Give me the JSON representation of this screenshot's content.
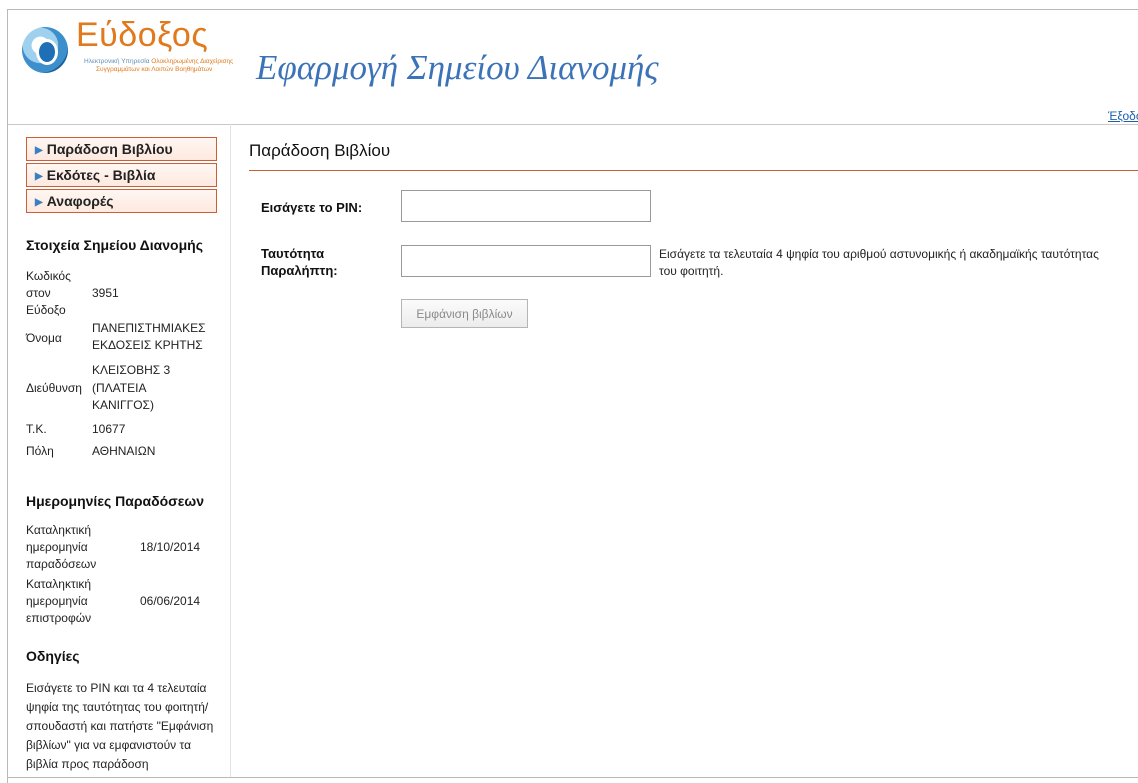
{
  "header": {
    "logo_title": "Εύδοξος",
    "logo_sub_prefix": "Ηλεκτρονική Υπηρεσία ",
    "logo_sub_accent": "Ολοκληρωμένης Διαχείρισης",
    "logo_sub_line2": "Συγγραμμάτων και Λοιπών Βοηθημάτων",
    "app_title": "Εφαρμογή Σημείου Διανομής",
    "logout_label": "Έξοδο"
  },
  "sidebar": {
    "menu": [
      {
        "label": "Παράδοση Βιβλίου"
      },
      {
        "label": "Εκδότες - Βιβλία"
      },
      {
        "label": "Αναφορές"
      }
    ],
    "point_heading": "Στοιχεία Σημείου Διανομής",
    "point_info": {
      "code_label_1": "Κωδικός",
      "code_label_2": "στον",
      "code_label_3": "Εύδοξο",
      "code_value": "3951",
      "name_label": "Όνομα",
      "name_value_1": "ΠΑΝΕΠΙΣΤΗΜΙΑΚΕΣ",
      "name_value_2": "ΕΚΔΟΣΕΙΣ ΚΡΗΤΗΣ",
      "address_label": "Διεύθυνση",
      "address_value_1": "ΚΛΕΙΣΟΒΗΣ 3",
      "address_value_2": "(ΠΛΑΤΕΙΑ",
      "address_value_3": "ΚΑΝΙΓΓΟΣ)",
      "zip_label": "Τ.Κ.",
      "zip_value": "10677",
      "city_label": "Πόλη",
      "city_value": "ΑΘΗΝΑΙΩΝ"
    },
    "dates_heading": "Ημερομηνίες Παραδόσεων",
    "dates": {
      "delivery_label_1": "Καταληκτική",
      "delivery_label_2": "ημερομηνία",
      "delivery_label_3": "παραδόσεων",
      "delivery_value": "18/10/2014",
      "return_label_1": "Καταληκτική",
      "return_label_2": "ημερομηνία",
      "return_label_3": "επιστροφών",
      "return_value": "06/06/2014"
    },
    "instructions_heading": "Οδηγίες",
    "instructions_text": "Εισάγετε το PIN και τα 4 τελευταία ψηφία της ταυτότητας του φοιτητή/σπουδαστή και πατήστε \"Εμφάνιση βιβλίων\" για να εμφανιστούν τα βιβλία προς παράδοση"
  },
  "main": {
    "title": "Παράδοση Βιβλίου",
    "pin_label": "Εισάγετε το PIN:",
    "pin_value": "",
    "id_label_1": "Ταυτότητα",
    "id_label_2": "Παραλήπτη:",
    "id_value": "",
    "id_help": "Εισάγετε τα τελευταία 4 ψηφία του αριθμού αστυνομικής ή ακαδημαϊκής ταυτότητας του φοιτητή.",
    "show_button_label": "Εμφάνιση βιβλίων"
  }
}
